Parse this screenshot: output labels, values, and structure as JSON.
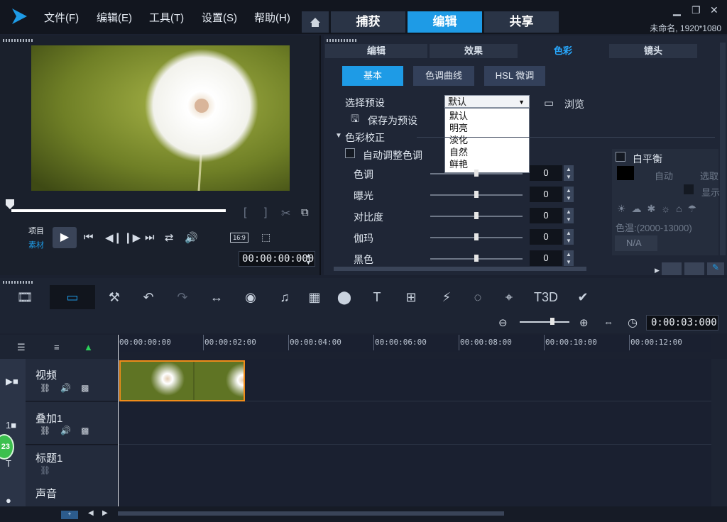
{
  "app": {
    "menu": [
      "文件(F)",
      "编辑(E)",
      "工具(T)",
      "设置(S)",
      "帮助(H)"
    ],
    "tabs": [
      "捕获",
      "编辑",
      "共享"
    ],
    "active_tab": "编辑",
    "project_info": "未命名, 1920*1080"
  },
  "player": {
    "mode_project": "项目",
    "mode_clip": "素材",
    "aspect": "16:9",
    "timecode": "00:00:00:000"
  },
  "options": {
    "subtabs": [
      "编辑",
      "效果",
      "色彩",
      "镜头"
    ],
    "active_subtab": "色彩",
    "buttons": [
      "基本",
      "色调曲线",
      "HSL 微调"
    ],
    "active_button": "基本",
    "preset_label": "选择预设",
    "preset_value": "默认",
    "browse": "浏览",
    "save_preset": "保存为预设",
    "preset_options": [
      "默认",
      "明亮",
      "淡化",
      "自然",
      "鲜艳"
    ],
    "section": "色彩校正",
    "auto_tone": "自动调整色调",
    "sliders": [
      {
        "label": "色调",
        "value": "0",
        "level": 0.5
      },
      {
        "label": "曝光",
        "value": "0",
        "level": 0.5
      },
      {
        "label": "对比度",
        "value": "0",
        "level": 0.5
      },
      {
        "label": "伽玛",
        "value": "0",
        "level": 0.5
      },
      {
        "label": "黑色",
        "value": "0",
        "level": 0.5
      }
    ],
    "white_balance": {
      "title": "白平衡",
      "auto": "自动",
      "pick": "选取",
      "show": "显示",
      "temp": "色温:(2000-13000)",
      "temp_value": "N/A"
    }
  },
  "timeline": {
    "timecode": "0:00:03:000",
    "ticks": [
      "00:00:00:00",
      "00:00:02:00",
      "00:00:04:00",
      "00:00:06:00",
      "00:00:08:00",
      "00:00:10:00",
      "00:00:12:00"
    ],
    "tracks": [
      "视频",
      "叠加1",
      "标题1",
      "声音"
    ],
    "badge": "23"
  },
  "colors": {
    "accent": "#1e9be6",
    "clip_border": "#f08c1a"
  }
}
